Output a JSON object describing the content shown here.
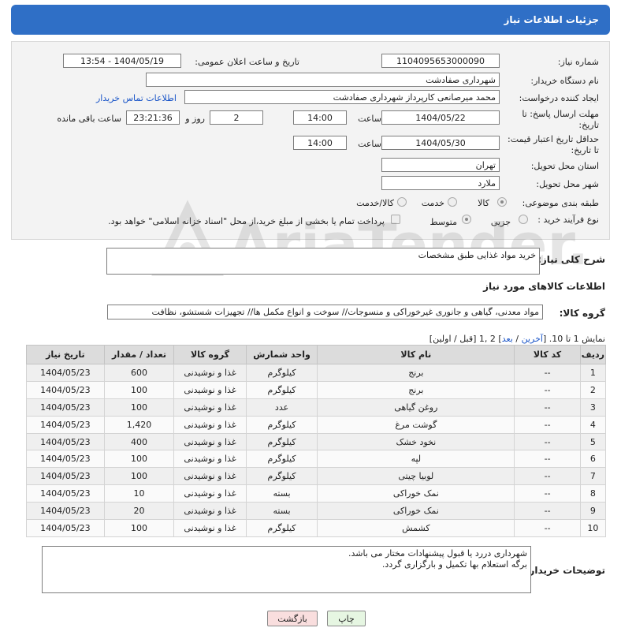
{
  "header": {
    "title": "جزئیات اطلاعات نیاز"
  },
  "form": {
    "need_number": {
      "label": "شماره نیاز:",
      "value": "1104095653000090"
    },
    "announce_date": {
      "label": "تاریخ و ساعت اعلان عمومی:",
      "value": "1404/05/19 - 13:54"
    },
    "buyer_org": {
      "label": "نام دستگاه خریدار:",
      "value": "شهرداری صفادشت"
    },
    "requester": {
      "label": "ایجاد کننده درخواست:",
      "value": "محمد میرصانعی کارپرداز شهرداری صفادشت",
      "contact_link": "اطلاعات تماس خریدار"
    },
    "reply_deadline": {
      "label_line1": "مهلت ارسال پاسخ: تا",
      "label_line2": "تاریخ:",
      "date": "1404/05/22",
      "time_label": "ساعت",
      "time": "14:00",
      "days": "2",
      "days_label": "روز و",
      "remaining": "23:21:36",
      "remaining_label": "ساعت باقی مانده"
    },
    "price_validity": {
      "label_line1": "حداقل تاریخ اعتبار قیمت:",
      "label_line2": "تا تاریخ:",
      "date": "1404/05/30",
      "time_label": "ساعت",
      "time": "14:00"
    },
    "province": {
      "label": "استان محل تحویل:",
      "value": "تهران"
    },
    "city": {
      "label": "شهر محل تحویل:",
      "value": "ملارد"
    },
    "category": {
      "label": "طبقه بندی موضوعی:",
      "options": [
        "کالا",
        "خدمت",
        "کالا/خدمت"
      ],
      "selected": "کالا"
    },
    "process": {
      "label": "نوع فرآیند خرید :",
      "options": [
        "جزیی",
        "متوسط"
      ],
      "selected": "متوسط",
      "treasury_note": "پرداخت تمام یا بخشی از مبلغ خرید،از محل \"اسناد خزانه اسلامی\" خواهد بود."
    }
  },
  "description": {
    "label": "شرح کلی نیاز:",
    "value": "خرید مواد غذایی طبق مشخصات"
  },
  "goods_section": {
    "title": "اطلاعات کالاهای مورد نیاز"
  },
  "goods_group": {
    "label": "گروه کالا:",
    "value": "مواد معدنی، گیاهی و جانوری غیرخوراکی و منسوجات// سوخت و انواع مکمل ها// تجهیزات شستشو، نظافت"
  },
  "pagination": {
    "prefix": "نمایش 1 تا 10. [",
    "last": "آخرین",
    "sep1": " / ",
    "next": "بعد",
    "pages": "] 2 ,1 [قبل / اولین]"
  },
  "table": {
    "headers": [
      "ردیف",
      "کد کالا",
      "نام کالا",
      "واحد شمارش",
      "گروه کالا",
      "تعداد / مقدار",
      "تاریخ نیاز"
    ],
    "rows": [
      [
        "1",
        "--",
        "برنج",
        "کیلوگرم",
        "غذا و نوشیدنی",
        "600",
        "1404/05/23"
      ],
      [
        "2",
        "--",
        "برنج",
        "کیلوگرم",
        "غذا و نوشیدنی",
        "100",
        "1404/05/23"
      ],
      [
        "3",
        "--",
        "روغن گیاهی",
        "عدد",
        "غذا و نوشیدنی",
        "100",
        "1404/05/23"
      ],
      [
        "4",
        "--",
        "گوشت مرغ",
        "کیلوگرم",
        "غذا و نوشیدنی",
        "1,420",
        "1404/05/23"
      ],
      [
        "5",
        "--",
        "نخود خشک",
        "کیلوگرم",
        "غذا و نوشیدنی",
        "400",
        "1404/05/23"
      ],
      [
        "6",
        "--",
        "لپه",
        "کیلوگرم",
        "غذا و نوشیدنی",
        "100",
        "1404/05/23"
      ],
      [
        "7",
        "--",
        "لوبیا چیتی",
        "کیلوگرم",
        "غذا و نوشیدنی",
        "100",
        "1404/05/23"
      ],
      [
        "8",
        "--",
        "نمک خوراکی",
        "بسته",
        "غذا و نوشیدنی",
        "10",
        "1404/05/23"
      ],
      [
        "9",
        "--",
        "نمک خوراکی",
        "بسته",
        "غذا و نوشیدنی",
        "20",
        "1404/05/23"
      ],
      [
        "10",
        "--",
        "کشمش",
        "کیلوگرم",
        "غذا و نوشیدنی",
        "100",
        "1404/05/23"
      ]
    ]
  },
  "buyer_notes": {
    "label": "توضیحات خریدار:",
    "line1": "شهرداری دررد یا قبول پیشنهادات مختار می باشد.",
    "line2": "برگه استعلام بها تکمیل و بارگزاری گردد."
  },
  "buttons": {
    "print": "چاپ",
    "back": "بازگشت"
  },
  "watermark": {
    "text": "AriaTender.neT"
  },
  "colors": {
    "header_bg": "#2f6fc6",
    "print_bg": "#e6f6e2",
    "back_bg": "#f9dede"
  }
}
